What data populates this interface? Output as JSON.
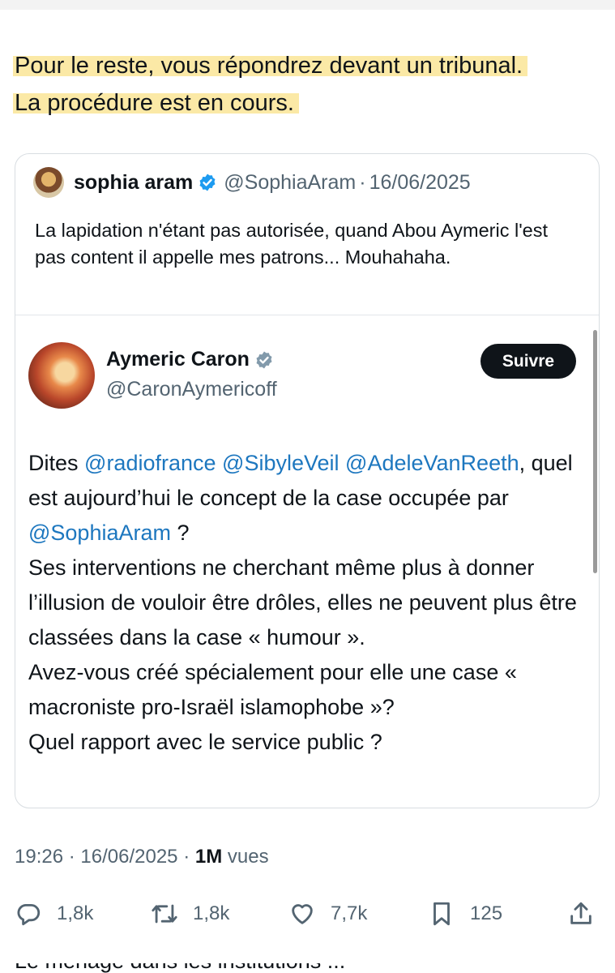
{
  "tweet": {
    "text_line1": "Pour le reste, vous répondrez devant un tribunal.",
    "text_line2": "La procédure est en cours."
  },
  "quoted": {
    "name": "sophia aram",
    "handle": "@SophiaAram",
    "date": "16/06/2025",
    "body": "La lapidation n'étant pas autorisée, quand Abou Aymeric l'est pas content il appelle mes patrons... Mouhahaha.",
    "embedded": {
      "name": "Aymeric Caron",
      "handle": "@CaronAymericoff",
      "follow_label": "Suivre",
      "body": {
        "p1_prefix": "Dites ",
        "m1": "@radiofrance",
        "m2": "@SibyleVeil",
        "m3": "@AdeleVanReeth",
        "p1_mid": ", quel est aujourd’hui le concept de la case occupée par ",
        "m4": "@SophiaAram",
        "p1_end": " ?",
        "p2": "Ses interventions ne cherchant même plus à donner l’illusion de vouloir être drôles, elles ne peuvent plus être classées dans la case « humour ».",
        "p3": "Avez-vous créé spécialement pour elle une case « macroniste pro-Israël islamophobe »?",
        "p4": "Quel rapport avec le service public ?"
      }
    }
  },
  "meta": {
    "time": "19:26",
    "date": "16/06/2025",
    "views_count": "1M",
    "views_label": "vues"
  },
  "actions": {
    "replies": "1,8k",
    "reposts": "1,8k",
    "likes": "7,7k",
    "bookmarks": "125"
  },
  "next_reply_partial": "Le ménage dans les institutions ...",
  "icons": [
    "verified-badge-icon",
    "grey-verified-badge-icon",
    "reply-icon",
    "repost-icon",
    "like-icon",
    "bookmark-icon",
    "share-icon"
  ],
  "colors": {
    "mention": "#1d77bf",
    "highlight": "#fbe9a6",
    "verified": "#1d9bf0",
    "follow_button": "#0f1419"
  }
}
